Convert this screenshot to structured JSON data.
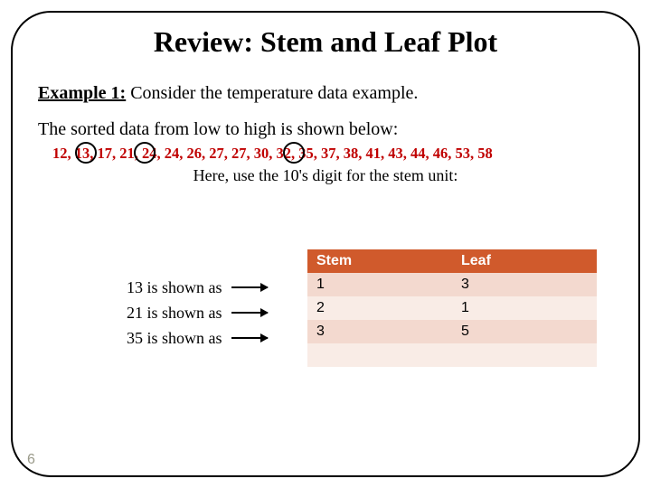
{
  "title": "Review: Stem and Leaf Plot",
  "example": {
    "label": "Example 1:",
    "text": " Consider the temperature data example."
  },
  "sorted_intro": "The sorted data from low to high is shown below:",
  "data_values": "12, 13, 17, 21, 24, 24, 26, 27, 27, 30, 32, 35, 37, 38, 41, 43, 44, 46, 53, 58",
  "stem_instruction": "Here, use the 10's digit for the stem unit:",
  "shown_as": [
    {
      "num": "13",
      "text": "13 is shown as"
    },
    {
      "num": "21",
      "text": "21 is shown as"
    },
    {
      "num": "35",
      "text": "35 is shown as"
    }
  ],
  "table": {
    "headers": {
      "stem": "Stem",
      "leaf": "Leaf"
    },
    "rows": [
      {
        "stem": "1",
        "leaf": "3"
      },
      {
        "stem": "2",
        "leaf": "1"
      },
      {
        "stem": "3",
        "leaf": "5"
      },
      {
        "stem": "",
        "leaf": ""
      }
    ]
  },
  "page_number": "6",
  "chart_data": {
    "type": "table",
    "title": "Stem and Leaf examples",
    "columns": [
      "Stem",
      "Leaf"
    ],
    "rows": [
      [
        1,
        3
      ],
      [
        2,
        1
      ],
      [
        3,
        5
      ]
    ],
    "source_values": [
      12,
      13,
      17,
      21,
      24,
      24,
      26,
      27,
      27,
      30,
      32,
      35,
      37,
      38,
      41,
      43,
      44,
      46,
      53,
      58
    ],
    "circled_values": [
      13,
      21,
      35
    ]
  }
}
